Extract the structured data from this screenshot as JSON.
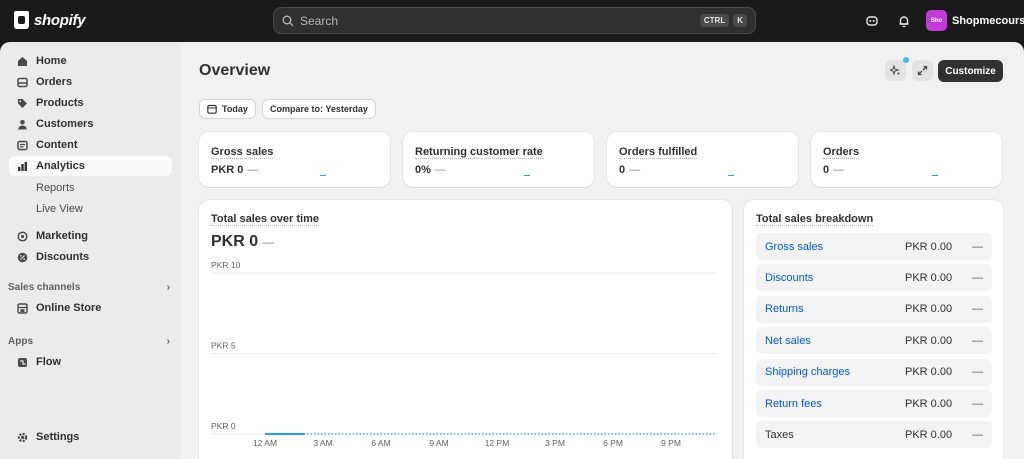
{
  "brand": {
    "name": "shopify"
  },
  "search": {
    "placeholder": "Search",
    "shortcut_keys": [
      "CTRL",
      "K"
    ]
  },
  "store": {
    "avatar_text": "Sho",
    "name": "Shopmecourse",
    "avatar_color": "#c23bd6"
  },
  "sidebar": {
    "items": [
      {
        "label": "Home",
        "icon": "home-icon"
      },
      {
        "label": "Orders",
        "icon": "inbox-icon"
      },
      {
        "label": "Products",
        "icon": "tag-icon"
      },
      {
        "label": "Customers",
        "icon": "person-icon"
      },
      {
        "label": "Content",
        "icon": "image-icon"
      },
      {
        "label": "Analytics",
        "icon": "bar-chart-icon",
        "active": true
      }
    ],
    "analytics_sub": [
      "Reports",
      "Live View"
    ],
    "marketing": {
      "label": "Marketing",
      "icon": "target-icon"
    },
    "discounts": {
      "label": "Discounts",
      "icon": "discount-icon"
    },
    "sales_channels_label": "Sales channels",
    "online_store": {
      "label": "Online Store",
      "icon": "store-icon"
    },
    "apps_label": "Apps",
    "flow": {
      "label": "Flow",
      "icon": "flow-icon"
    },
    "settings": {
      "label": "Settings",
      "icon": "gear-icon"
    }
  },
  "main": {
    "title": "Overview",
    "customize_label": "Customize",
    "date_label": "Today",
    "compare_label": "Compare to: Yesterday",
    "accent_color": "#29a0e5",
    "metrics": [
      {
        "label": "Gross sales",
        "value": "PKR 0",
        "change": "—"
      },
      {
        "label": "Returning customer rate",
        "value": "0%",
        "change": "—"
      },
      {
        "label": "Orders fulfilled",
        "value": "0",
        "change": "—"
      },
      {
        "label": "Orders",
        "value": "0",
        "change": "—"
      }
    ],
    "breakdown": {
      "title": "Total sales breakdown",
      "rows": [
        {
          "name": "Gross sales",
          "value": "PKR 0.00",
          "change": "—",
          "link": true
        },
        {
          "name": "Discounts",
          "value": "PKR 0.00",
          "change": "—",
          "link": true
        },
        {
          "name": "Returns",
          "value": "PKR 0.00",
          "change": "—",
          "link": true
        },
        {
          "name": "Net sales",
          "value": "PKR 0.00",
          "change": "—",
          "link": true
        },
        {
          "name": "Shipping charges",
          "value": "PKR 0.00",
          "change": "—",
          "link": true
        },
        {
          "name": "Return fees",
          "value": "PKR 0.00",
          "change": "—",
          "link": true
        },
        {
          "name": "Taxes",
          "value": "PKR 0.00",
          "change": "—",
          "link": false
        }
      ]
    }
  },
  "chart_data": {
    "type": "line",
    "title": "Total sales over time",
    "total": "PKR 0",
    "total_change": "—",
    "categories": [
      "12 AM",
      "3 AM",
      "6 AM",
      "9 AM",
      "12 PM",
      "3 PM",
      "6 PM",
      "9 PM"
    ],
    "y_tick_labels": [
      "PKR 10",
      "PKR 5",
      "PKR 0"
    ],
    "ylim": [
      0,
      10
    ],
    "series": [
      {
        "values": [
          0,
          0
        ],
        "style": "solid",
        "color": "#29a0e5"
      },
      {
        "values": [
          0,
          0,
          0,
          0,
          0,
          0,
          0,
          0
        ],
        "style": "dotted",
        "color": "#29a0e5"
      }
    ],
    "grid": true
  }
}
